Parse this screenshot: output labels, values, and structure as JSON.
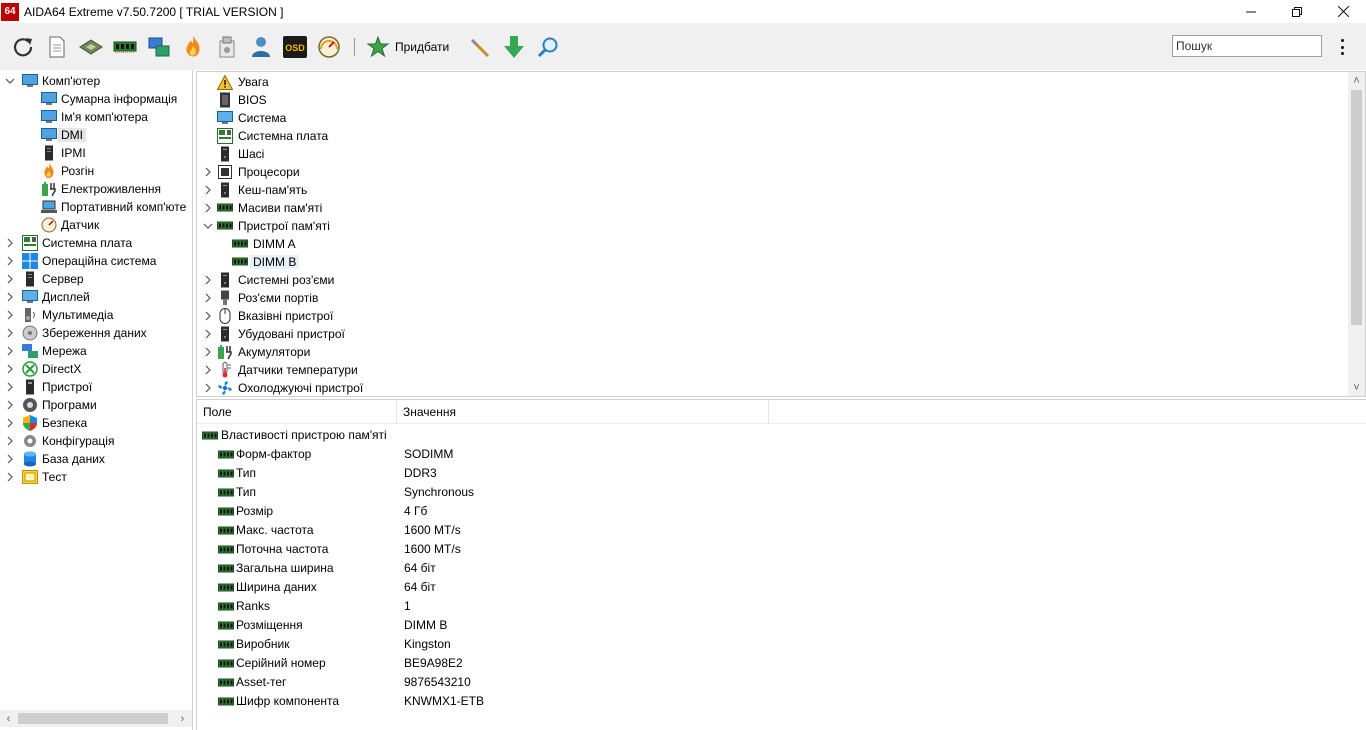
{
  "window": {
    "title": "AIDA64 Extreme v7.50.7200  [ TRIAL VERSION ]",
    "app_icon_text": "64"
  },
  "toolbar": {
    "icons": [
      "refresh-icon",
      "report-icon",
      "motherboard-icon",
      "memory-icon",
      "network-icon",
      "flame-icon",
      "tools-icon",
      "user-icon",
      "osd-icon",
      "gauge-icon"
    ],
    "buy_label": "Придбати",
    "osd_text": "OSD",
    "search_placeholder": "Пошук"
  },
  "left_tree": {
    "items": [
      {
        "label": "Комп'ютер",
        "icon": "computer-icon",
        "level": 0,
        "expanded": true
      },
      {
        "label": "Сумарна інформація",
        "icon": "computer-icon",
        "level": 1
      },
      {
        "label": "Ім'я комп'ютера",
        "icon": "computer-icon",
        "level": 1
      },
      {
        "label": "DMI",
        "icon": "computer-icon",
        "level": 1,
        "selected": true
      },
      {
        "label": "IPMI",
        "icon": "server-icon",
        "level": 1
      },
      {
        "label": "Розгін",
        "icon": "flame-icon",
        "level": 1
      },
      {
        "label": "Електроживлення",
        "icon": "power-icon",
        "level": 1
      },
      {
        "label": "Портативний комп'юте",
        "icon": "laptop-icon",
        "level": 1
      },
      {
        "label": "Датчик",
        "icon": "gauge-icon",
        "level": 1
      },
      {
        "label": "Системна плата",
        "icon": "motherboard-icon",
        "level": 0
      },
      {
        "label": "Операційна система",
        "icon": "windows-icon",
        "level": 0
      },
      {
        "label": "Сервер",
        "icon": "server-icon",
        "level": 0
      },
      {
        "label": "Дисплей",
        "icon": "monitor-icon",
        "level": 0
      },
      {
        "label": "Мультимедіа",
        "icon": "speaker-icon",
        "level": 0
      },
      {
        "label": "Збереження даних",
        "icon": "disk-icon",
        "level": 0
      },
      {
        "label": "Мережа",
        "icon": "network-icon",
        "level": 0
      },
      {
        "label": "DirectX",
        "icon": "xbox-icon",
        "level": 0
      },
      {
        "label": "Пристрої",
        "icon": "device-icon",
        "level": 0
      },
      {
        "label": "Програми",
        "icon": "programs-icon",
        "level": 0
      },
      {
        "label": "Безпека",
        "icon": "shield-icon",
        "level": 0
      },
      {
        "label": "Конфігурація",
        "icon": "config-icon",
        "level": 0
      },
      {
        "label": "База даних",
        "icon": "database-icon",
        "level": 0
      },
      {
        "label": "Тест",
        "icon": "benchmark-icon",
        "level": 0
      }
    ]
  },
  "upper_tree": {
    "items": [
      {
        "label": "Увага",
        "icon": "warning-icon",
        "chev": ""
      },
      {
        "label": "BIOS",
        "icon": "chip-icon",
        "chev": ""
      },
      {
        "label": "Система",
        "icon": "monitor-icon",
        "chev": ""
      },
      {
        "label": "Системна плата",
        "icon": "motherboard-icon",
        "chev": ""
      },
      {
        "label": "Шасі",
        "icon": "tower-icon",
        "chev": ""
      },
      {
        "label": "Процесори",
        "icon": "cpu-icon",
        "chev": "right"
      },
      {
        "label": "Кеш-пам'ять",
        "icon": "tower-icon",
        "chev": "right"
      },
      {
        "label": "Масиви пам'яті",
        "icon": "ram-icon",
        "chev": "right"
      },
      {
        "label": "Пристрої пам'яті",
        "icon": "ram-icon",
        "chev": "down"
      },
      {
        "label": "DIMM A",
        "icon": "ram-icon",
        "chev": "",
        "child": true
      },
      {
        "label": "DIMM B",
        "icon": "ram-icon",
        "chev": "",
        "child": true,
        "selected": true
      },
      {
        "label": "Системні роз'єми",
        "icon": "tower-icon",
        "chev": "right"
      },
      {
        "label": "Роз'єми портів",
        "icon": "port-icon",
        "chev": "right"
      },
      {
        "label": "Вказівні пристрої",
        "icon": "mouse-icon",
        "chev": "right"
      },
      {
        "label": "Убудовані пристрої",
        "icon": "tower-icon",
        "chev": "right"
      },
      {
        "label": "Акумулятори",
        "icon": "battery-icon",
        "chev": "right"
      },
      {
        "label": "Датчики температури",
        "icon": "thermometer-icon",
        "chev": "right"
      },
      {
        "label": "Охолоджуючі пристрої",
        "icon": "fan-icon",
        "chev": "right"
      }
    ]
  },
  "details": {
    "col_field": "Поле",
    "col_value": "Значення",
    "group": "Властивості пристрою пам'яті",
    "rows": [
      {
        "field": "Форм-фактор",
        "value": "SODIMM"
      },
      {
        "field": "Тип",
        "value": "DDR3"
      },
      {
        "field": "Тип",
        "value": "Synchronous"
      },
      {
        "field": "Розмір",
        "value": "4 Гб"
      },
      {
        "field": "Макс. частота",
        "value": "1600 MT/s"
      },
      {
        "field": "Поточна частота",
        "value": "1600 MT/s"
      },
      {
        "field": "Загальна ширина",
        "value": "64 біт"
      },
      {
        "field": "Ширина даних",
        "value": "64 біт"
      },
      {
        "field": "Ranks",
        "value": "1"
      },
      {
        "field": "Розміщення",
        "value": "DIMM B"
      },
      {
        "field": "Виробник",
        "value": "Kingston"
      },
      {
        "field": "Серійний номер",
        "value": "BE9A98E2"
      },
      {
        "field": "Asset-тег",
        "value": "9876543210"
      },
      {
        "field": "Шифр компонента",
        "value": "KNWMX1-ETB"
      }
    ]
  }
}
